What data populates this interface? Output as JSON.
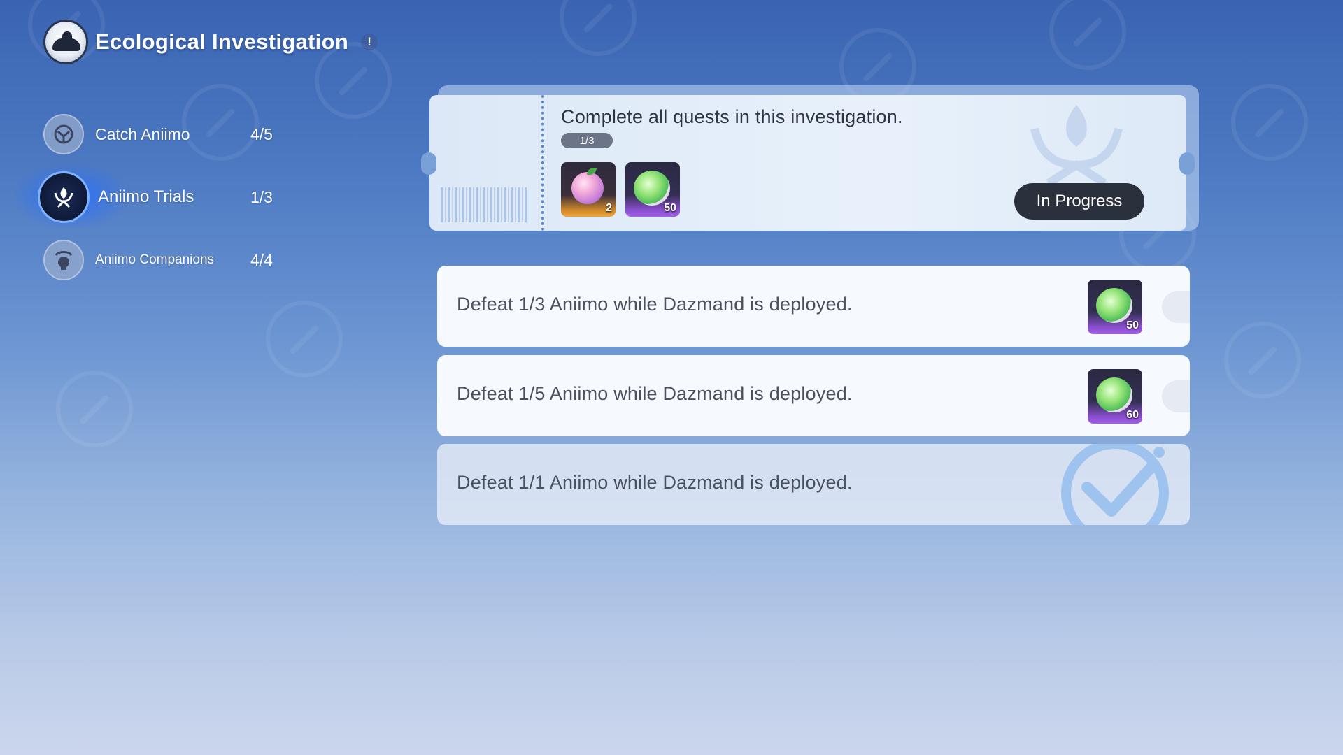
{
  "header": {
    "title": "Ecological Investigation",
    "info_badge": "!"
  },
  "sidebar": {
    "items": [
      {
        "label": "Catch Aniimo",
        "count": "4/5",
        "icon": "catch-icon",
        "active": false
      },
      {
        "label": "Aniimo Trials",
        "count": "1/3",
        "icon": "trials-icon",
        "active": true
      },
      {
        "label": "Aniimo Companions",
        "count": "4/4",
        "icon": "companions-icon",
        "active": false
      }
    ]
  },
  "ticket": {
    "title": "Complete all quests in this investigation.",
    "progress": "1/3",
    "rewards": [
      {
        "icon": "peach-fruit-icon",
        "qty": "2",
        "rarity": "gold"
      },
      {
        "icon": "melon-fruit-icon",
        "qty": "50",
        "rarity": "purple"
      }
    ],
    "status": "In Progress"
  },
  "quests": [
    {
      "text": "Defeat 1/3 Aniimo while Dazmand is deployed.",
      "reward_qty": "50",
      "reward_icon": "melon-fruit-icon",
      "completed": false
    },
    {
      "text": "Defeat 1/5 Aniimo while Dazmand is deployed.",
      "reward_qty": "60",
      "reward_icon": "melon-fruit-icon",
      "completed": false
    },
    {
      "text": "Defeat 1/1 Aniimo while Dazmand is deployed.",
      "completed": true
    }
  ],
  "colors": {
    "accent_glow": "#2e6eff",
    "status_button": "#2b303d",
    "gold_rarity": "#f0a63a",
    "purple_rarity": "#a45fe8"
  }
}
